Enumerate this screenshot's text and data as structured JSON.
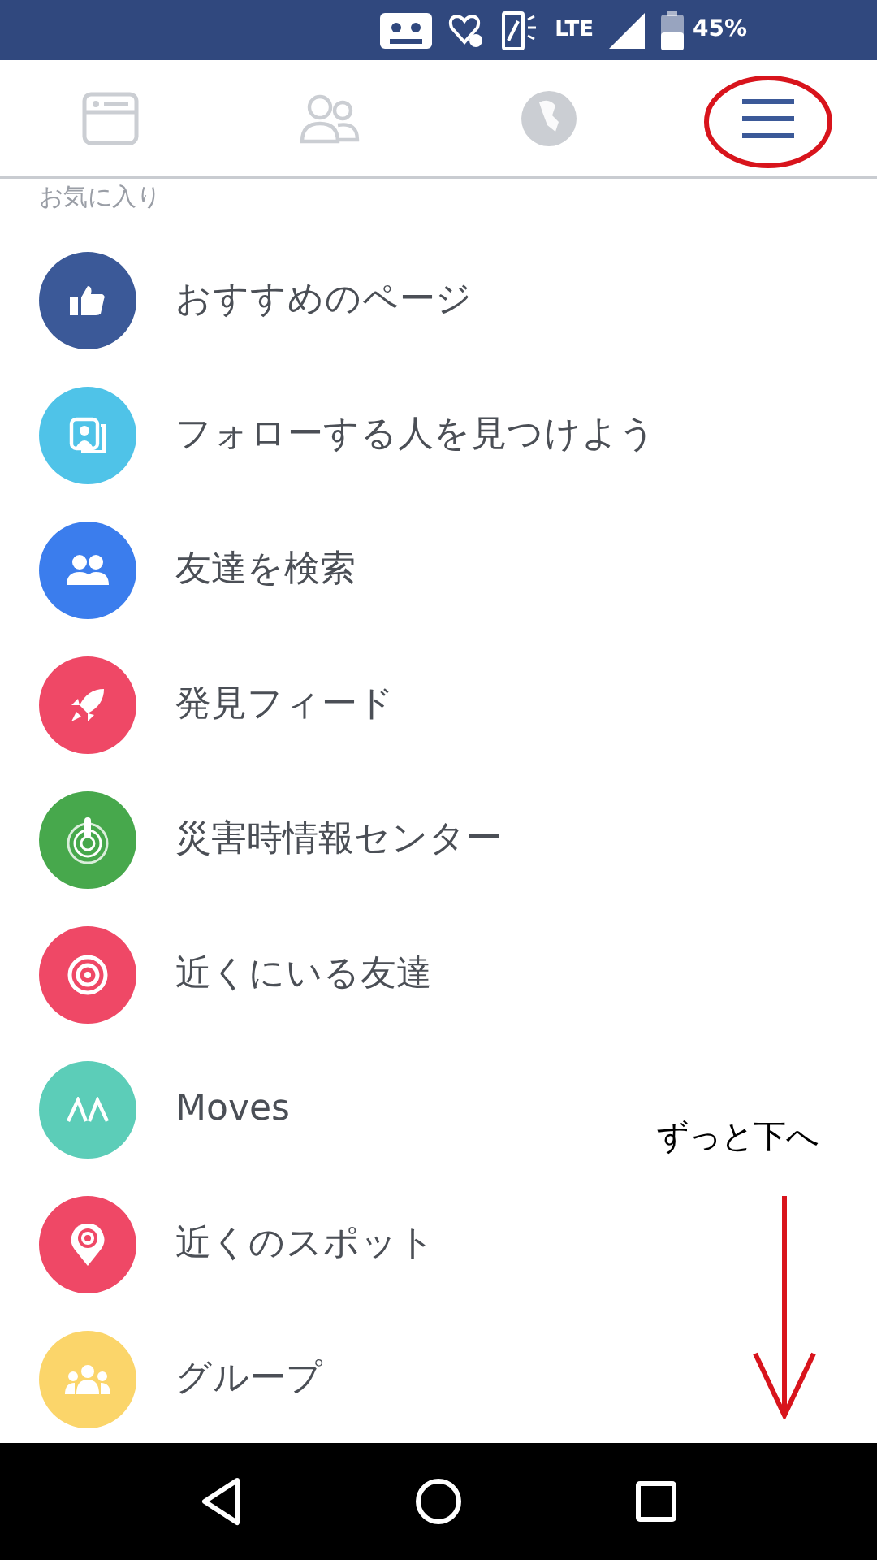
{
  "status_bar": {
    "battery": "45%",
    "network": "LTE"
  },
  "tabs": [
    {
      "selected": false
    },
    {
      "selected": false
    },
    {
      "selected": false
    },
    {
      "selected": true
    }
  ],
  "section_title": "お気に入り",
  "items": [
    {
      "label": "おすすめのページ",
      "color": "#3b5998"
    },
    {
      "label": "フォローする人を見つけよう",
      "color": "#4fc3e8"
    },
    {
      "label": "友達を検索",
      "color": "#3b7ded"
    },
    {
      "label": "発見フィード",
      "color": "#ef4866"
    },
    {
      "label": "災害時情報センター",
      "color": "#47a84c"
    },
    {
      "label": "近くにいる友達",
      "color": "#ef4866"
    },
    {
      "label": "Moves",
      "color": "#5ccdb8"
    },
    {
      "label": "近くのスポット",
      "color": "#ef4866"
    },
    {
      "label": "グループ",
      "color": "#fbd56a"
    }
  ],
  "annotation": {
    "text": "ずっと下へ"
  }
}
